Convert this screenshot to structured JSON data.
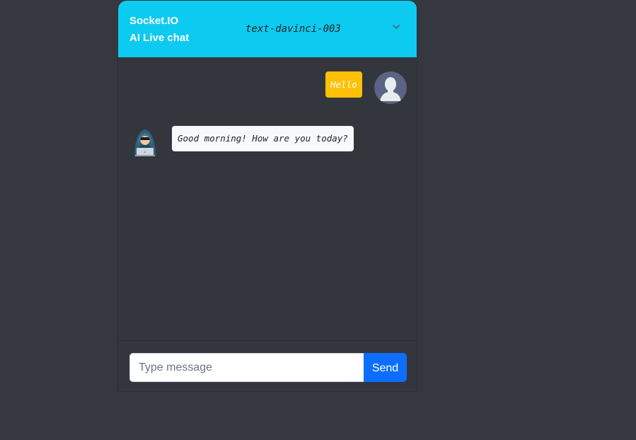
{
  "header": {
    "title_line1": "Socket.IO",
    "title_line2": "AI Live chat",
    "model_select": {
      "selected": "text-davinci-003",
      "icon": "chevron-down-icon"
    }
  },
  "messages": [
    {
      "sender": "user",
      "text": "Hello",
      "avatar": "user-avatar-icon"
    },
    {
      "sender": "ai",
      "text": "Good morning! How are you today?",
      "avatar": "hacker-avatar-icon"
    }
  ],
  "composer": {
    "placeholder": "Type message",
    "value": "",
    "send_label": "Send"
  },
  "colors": {
    "page_background": "#35383e",
    "header_accent": "#0dcaf0",
    "user_bubble": "#ffc107",
    "ai_bubble": "#f8f9fa",
    "send_button": "#0d6efd"
  }
}
